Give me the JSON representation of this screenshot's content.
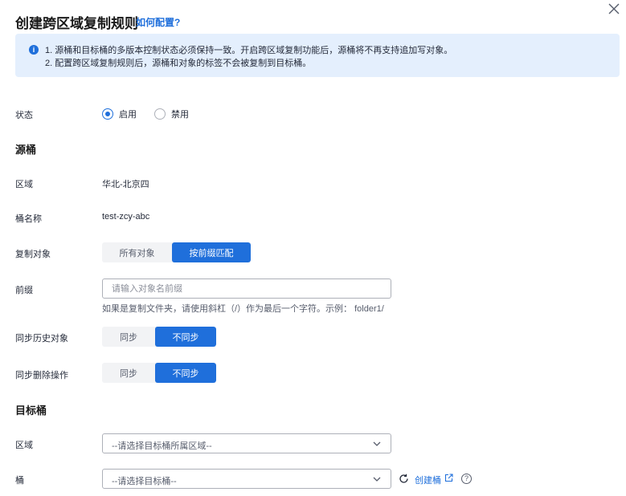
{
  "header": {
    "title": "创建跨区域复制规则",
    "help_link": "如何配置?"
  },
  "notice": {
    "icon": "info-icon",
    "line1": "1. 源桶和目标桶的多版本控制状态必须保持一致。开启跨区域复制功能后，源桶将不再支持追加写对象。",
    "line2": "2. 配置跨区域复制规则后，源桶和对象的标签不会被复制到目标桶。"
  },
  "status": {
    "label": "状态",
    "options": [
      "启用",
      "禁用"
    ],
    "selected": "启用"
  },
  "source": {
    "section_title": "源桶",
    "region_label": "区域",
    "region_value": "华北-北京四",
    "bucket_label": "桶名称",
    "bucket_value": "test-zcy-abc",
    "copy_object_label": "复制对象",
    "copy_object_options": [
      "所有对象",
      "按前缀匹配"
    ],
    "copy_object_selected": "按前缀匹配",
    "prefix_label": "前缀",
    "prefix_placeholder": "请输入对象名前缀",
    "prefix_value": "",
    "prefix_hint": "如果是复制文件夹，请使用斜杠（/）作为最后一个字符。示例：  folder1/",
    "sync_history_label": "同步历史对象",
    "sync_history_options": [
      "同步",
      "不同步"
    ],
    "sync_history_selected": "不同步",
    "sync_delete_label": "同步删除操作",
    "sync_delete_options": [
      "同步",
      "不同步"
    ],
    "sync_delete_selected": "不同步"
  },
  "target": {
    "section_title": "目标桶",
    "region_label": "区域",
    "region_placeholder": "--请选择目标桶所属区域--",
    "bucket_label": "桶",
    "bucket_placeholder": "--请选择目标桶--",
    "create_bucket_link": "创建桶"
  },
  "colors": {
    "accent": "#1f6fdb",
    "notice_bg": "#e4effd"
  }
}
